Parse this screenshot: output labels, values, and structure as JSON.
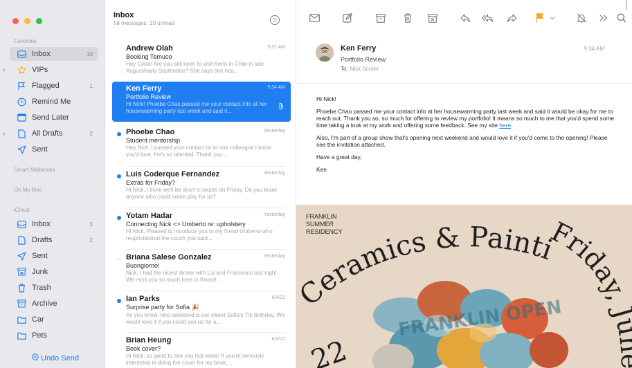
{
  "sidebar": {
    "section_favorites": "Favorites",
    "section_smart": "Smart Mailboxes",
    "section_on_my_mac": "On My Mac",
    "section_icloud": "iCloud",
    "favorites": [
      {
        "label": "Inbox",
        "count": "10",
        "icon": "inbox-icon"
      },
      {
        "label": "VIPs",
        "count": "",
        "icon": "star-icon"
      },
      {
        "label": "Flagged",
        "count": "1",
        "icon": "flag-icon"
      },
      {
        "label": "Remind Me",
        "count": "",
        "icon": "clock-icon"
      },
      {
        "label": "Send Later",
        "count": "",
        "icon": "calendar-icon"
      },
      {
        "label": "All Drafts",
        "count": "2",
        "icon": "doc-icon"
      },
      {
        "label": "Sent",
        "count": "",
        "icon": "paperplane-icon"
      }
    ],
    "icloud": [
      {
        "label": "Inbox",
        "count": "3",
        "icon": "inbox-icon"
      },
      {
        "label": "Drafts",
        "count": "2",
        "icon": "doc-icon"
      },
      {
        "label": "Sent",
        "count": "",
        "icon": "paperplane-icon"
      },
      {
        "label": "Junk",
        "count": "",
        "icon": "junk-icon"
      },
      {
        "label": "Trash",
        "count": "",
        "icon": "trash-icon"
      },
      {
        "label": "Archive",
        "count": "",
        "icon": "archive-icon"
      },
      {
        "label": "Car",
        "count": "",
        "icon": "folder-icon"
      },
      {
        "label": "Pets",
        "count": "",
        "icon": "folder-icon"
      }
    ],
    "undo_send": "Undo Send"
  },
  "list": {
    "title": "Inbox",
    "subtitle": "58 messages, 10 unread",
    "messages": [
      {
        "sender": "Andrew Olah",
        "date": "9:31 AM",
        "subject": "Booking Temuco",
        "preview": "Hey Ciara! Are you still keen to visit Kenn in Chile in late August/early September? She says she has...",
        "unread": false
      },
      {
        "sender": "Ken Ferry",
        "date": "9:34 AM",
        "subject": "Portfolio Review",
        "preview": "Hi Nick! Phoebe Chao passed me your contact info at her housewarming party last week and said it...",
        "unread": false
      },
      {
        "sender": "Phoebe Chao",
        "date": "Yesterday",
        "subject": "Student mentorship",
        "preview": "Hey Nick, I passed your contact on to one colleague I know you'd love. He's so talented. Thank you...",
        "unread": true
      },
      {
        "sender": "Luis Coderque Fernandez",
        "date": "Yesterday",
        "subject": "Extras for Friday?",
        "preview": "Hi Nick, I think we'll be short a couple on Friday. Do you know anyone who could come play for us?",
        "unread": true
      },
      {
        "sender": "Yotam Hadar",
        "date": "Yesterday",
        "subject": "Connecting Nick <> Umberto re: upholstery",
        "preview": "Hi Nick, Pleased to introduce you to my friend Umberto who reupholstered the couch you said...",
        "unread": true
      },
      {
        "sender": "Briana Salese Gonzalez",
        "date": "Yesterday",
        "subject": "Buongiorno!",
        "preview": "Nick, I had the nicest dinner with Lia and Francesco last night. We miss you so much here in Roma!...",
        "unread": false
      },
      {
        "sender": "Ian Parks",
        "date": "6/4/22",
        "subject": "Surprise party for Sofia 🎉",
        "preview": "As you know, next weekend is our sweet Sofia's 7th birthday. We would love it if you could join us for a...",
        "unread": true
      },
      {
        "sender": "Brian Heung",
        "date": "6/3/22",
        "subject": "Book cover?",
        "preview": "Hi Nick, so good to see you last week! If you're seriously interested in doing the cover for my book,...",
        "unread": false
      }
    ]
  },
  "toolbar": {
    "icons": [
      "envelope-icon",
      "compose-icon",
      "archive-icon",
      "trash-icon",
      "junk-icon",
      "reply-icon",
      "reply-all-icon",
      "forward-icon",
      "flag-icon",
      "mute-icon",
      "more-icon",
      "search-icon"
    ]
  },
  "message": {
    "from": "Ken Ferry",
    "subject": "Portfolio Review",
    "to_label": "To:",
    "to_name": "Nick Scroer",
    "time": "9:34 AM",
    "greeting": "Hi Nick!",
    "p1": "Phoebe Chao passed me your contact info at her housewarming party last week and said it would be okay for me to reach out. Thank you so, so much for offering to review my portfolio! It means so much to me that you'd spend some time taking a look at my work and offering some feedback. See my site ",
    "link": "here",
    "p1_end": ".",
    "p2": "Also, I'm part of a group show that's opening next weekend and would love it if you'd come to the opening! Please see the invitation attached.",
    "p3": "Have a great day,",
    "sign": "Ken"
  },
  "poster": {
    "line1": "FRANKLIN",
    "line2": "SUMMER",
    "line3": "RESIDENCY",
    "arc_text": "Ceramics & Painting",
    "side_text": "Friday, June",
    "year_text": "22",
    "sculpture_text": "FRANKLIN OPEN",
    "bg_color": "#e6d7c7"
  },
  "colors": {
    "accent": "#1f7ef2",
    "flag": "#f5a623",
    "close": "#ff5f57",
    "minimize": "#febc2e",
    "zoom": "#28c840"
  }
}
